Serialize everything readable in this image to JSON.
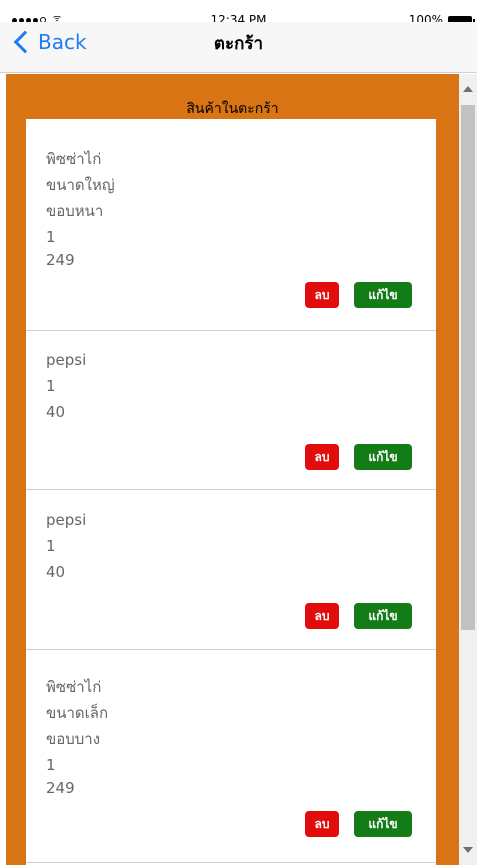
{
  "status_bar": {
    "wifi": "ᯤ",
    "time": "12:34 PM",
    "battery": "100%"
  },
  "nav": {
    "back_label": "Back",
    "title": "ตะกร้า"
  },
  "section": {
    "title": "สินค้าในตะกร้า"
  },
  "items": [
    {
      "lines": [
        "พิซซ่าไก่",
        "ขนาดใหญ่",
        "ขอบหนา",
        "1",
        "249"
      ],
      "delete_label": "ลบ",
      "edit_label": "แก้ไข"
    },
    {
      "lines": [
        "pepsi",
        "1",
        "40"
      ],
      "delete_label": "ลบ",
      "edit_label": "แก้ไข"
    },
    {
      "lines": [
        "pepsi",
        "1",
        "40"
      ],
      "delete_label": "ลบ",
      "edit_label": "แก้ไข"
    },
    {
      "lines": [
        "พิซซ่าไก่",
        "ขนาดเล็ก",
        "ขอบบาง",
        "1",
        "249"
      ],
      "delete_label": "ลบ",
      "edit_label": "แก้ไข"
    }
  ],
  "colors": {
    "background": "#d97414",
    "delete": "#e30c0c",
    "edit": "#137c16",
    "link": "#1f7cf3"
  },
  "icons": {
    "back": "chevron-left-icon",
    "scroll_up": "arrow-up-icon",
    "scroll_down": "arrow-down-icon"
  }
}
